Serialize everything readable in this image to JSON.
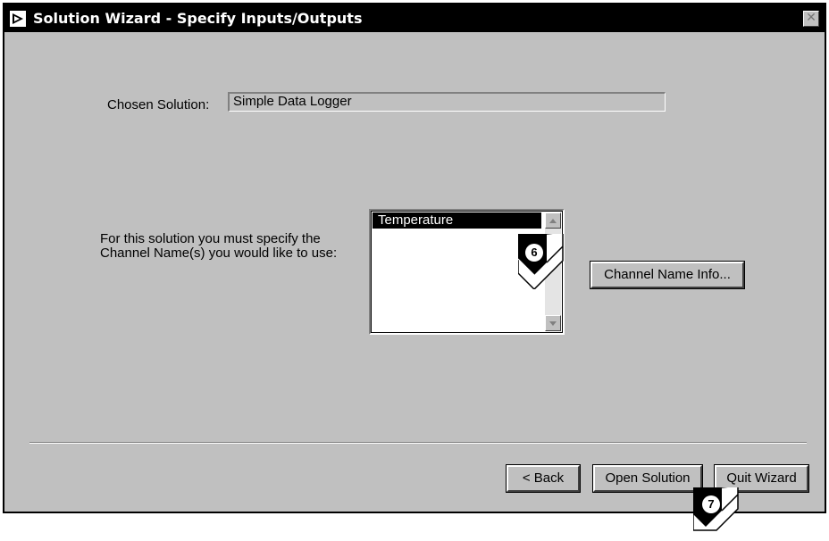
{
  "window": {
    "title": "Solution Wizard - Specify Inputs/Outputs",
    "close_glyph": "✕"
  },
  "chosen_solution": {
    "label": "Chosen Solution:",
    "value": "Simple Data Logger"
  },
  "channel": {
    "instruction_line1": "For this solution you must specify the",
    "instruction_line2": "Channel Name(s) you would like to use:",
    "list_items": [
      "Temperature"
    ],
    "info_button": "Channel Name Info..."
  },
  "footer": {
    "back_button": "< Back",
    "open_button": "Open Solution",
    "quit_button": "Quit Wizard"
  },
  "callouts": {
    "first": "6",
    "second": "7"
  },
  "icons": {
    "window": "labview-window-icon",
    "close": "close-icon",
    "scroll_up": "scroll-up-arrow-icon",
    "scroll_down": "scroll-down-arrow-icon",
    "callout": "callout-arrow-icon"
  }
}
